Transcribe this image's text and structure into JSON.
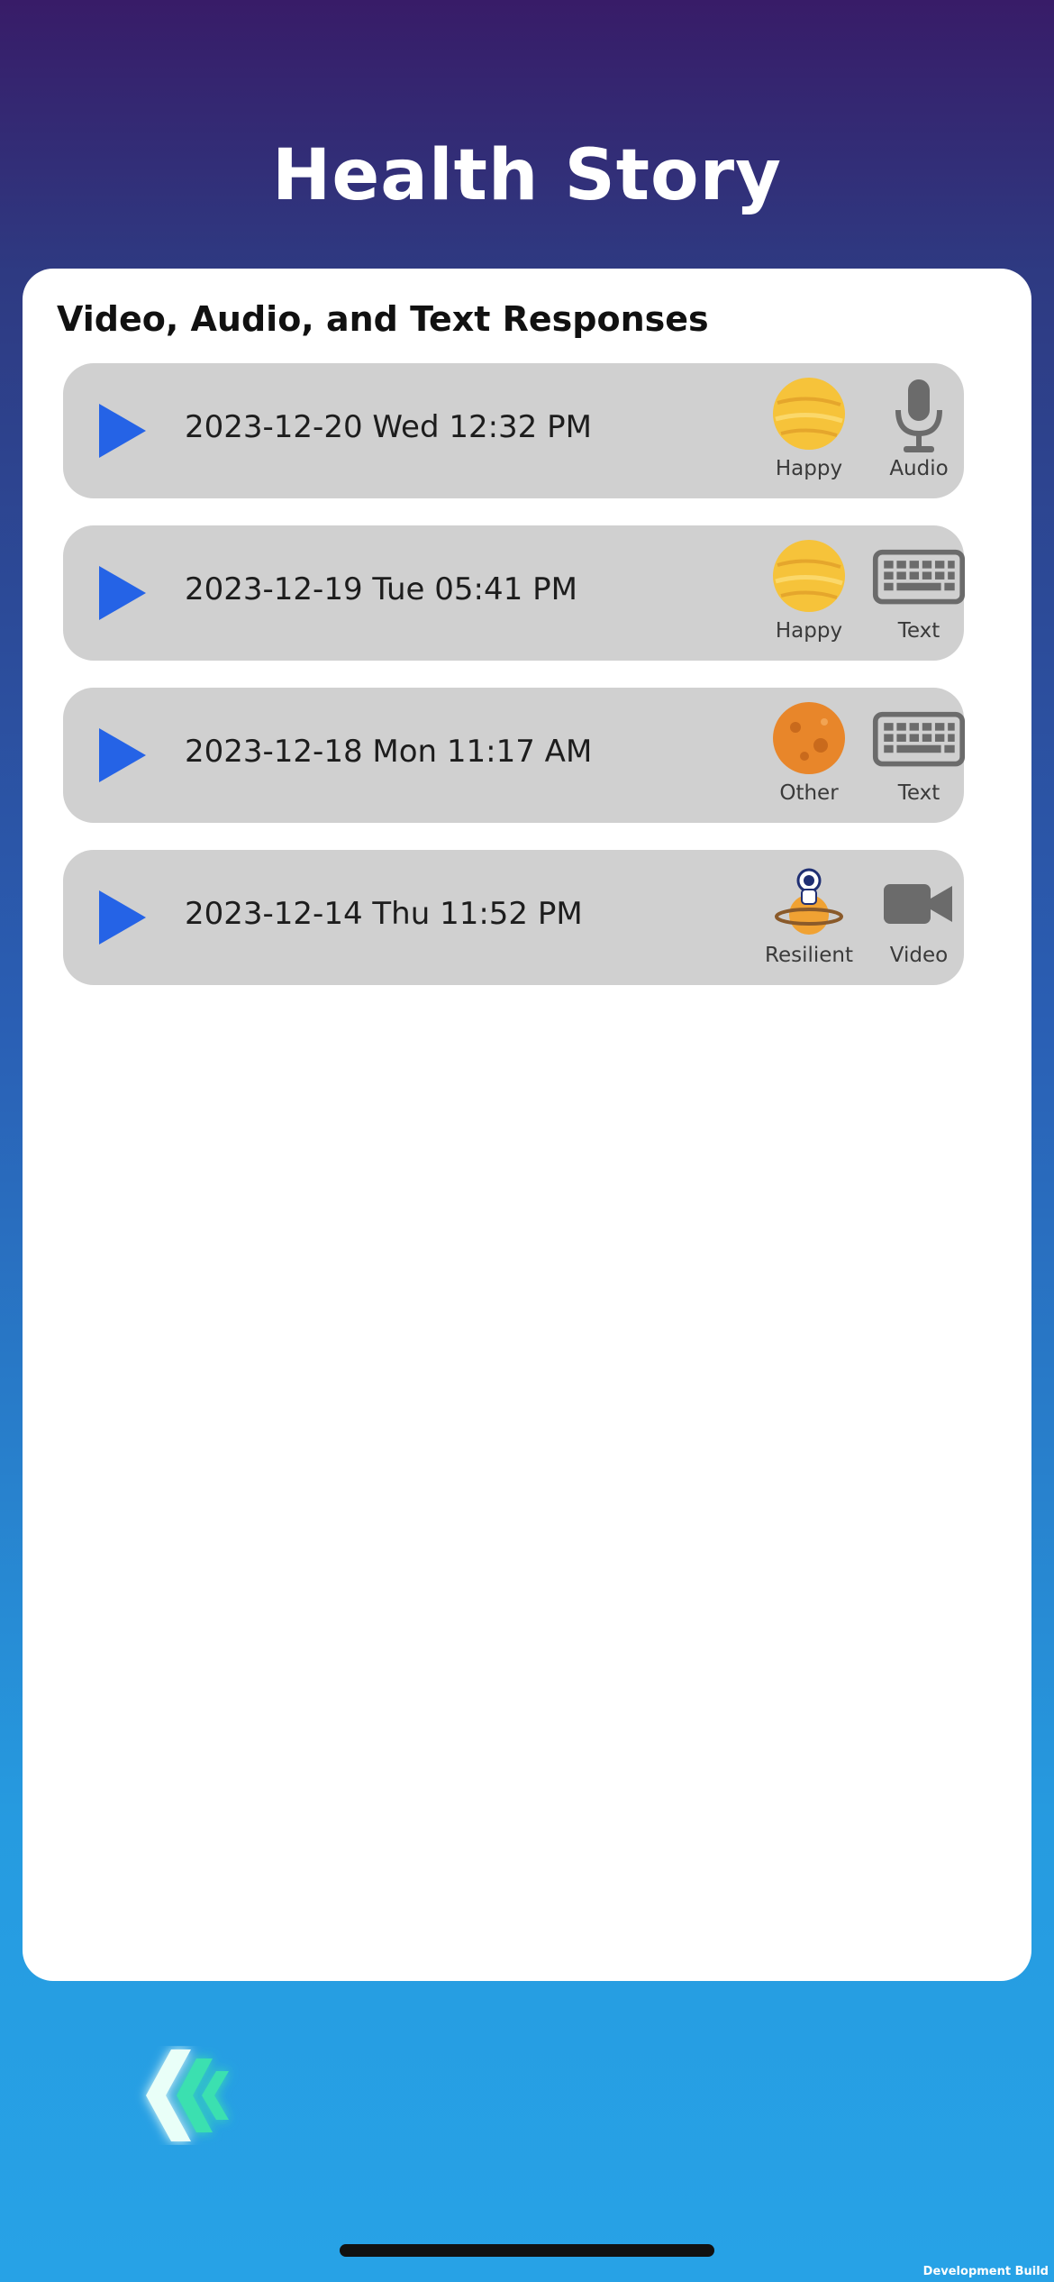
{
  "header": {
    "title": "Health Story"
  },
  "section": {
    "title": "Video, Audio, and Text Responses"
  },
  "responses": [
    {
      "date": "2023-12-20 Wed 12:32 PM",
      "mood": "Happy",
      "mood_icon": "yellow-planet-icon",
      "kind": "Audio",
      "kind_icon": "microphone-icon"
    },
    {
      "date": "2023-12-19 Tue 05:41 PM",
      "mood": "Happy",
      "mood_icon": "yellow-planet-icon",
      "kind": "Text",
      "kind_icon": "keyboard-icon"
    },
    {
      "date": "2023-12-18 Mon 11:17 AM",
      "mood": "Other",
      "mood_icon": "orange-planet-icon",
      "kind": "Text",
      "kind_icon": "keyboard-icon"
    },
    {
      "date": "2023-12-14 Thu 11:52 PM",
      "mood": "Resilient",
      "mood_icon": "astronaut-planet-icon",
      "kind": "Video",
      "kind_icon": "video-camera-icon"
    }
  ],
  "footer": {
    "dev_build": "Development Build",
    "back_icon": "back-chevron-icon"
  },
  "colors": {
    "accent": "#2563e6",
    "row_bg": "#d0d0d0",
    "icon_gray": "#6b6b6b",
    "back_green": "#3be0b0"
  }
}
